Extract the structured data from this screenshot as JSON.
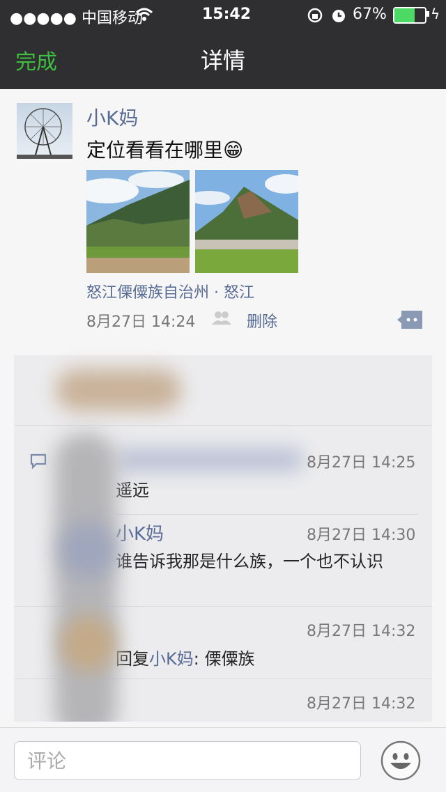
{
  "status_bar": {
    "carrier": "●●●●● 中国移动",
    "time": "15:42",
    "battery": "67%"
  },
  "nav": {
    "left_button": "完成",
    "title": "详情"
  },
  "post": {
    "author": "小K妈",
    "text": "定位看看在哪里",
    "emoji": "😁",
    "location": "怒江傈僳族自治州 · 怒江",
    "time": "8月27日 14:24",
    "delete_label": "删除"
  },
  "comments": [
    {
      "author": "",
      "time": "8月27日 14:25",
      "text": "遥远"
    },
    {
      "author": "小K妈",
      "time": "8月27日 14:30",
      "text": "谁告诉我那是什么族，一个也不认识"
    },
    {
      "author": "",
      "time": "8月27日 14:32",
      "reply_prefix": "回复",
      "reply_to": "小K妈",
      "text": ": 傈僳族"
    },
    {
      "author": "",
      "time": "8月27日 14:32",
      "text": ""
    }
  ],
  "input": {
    "placeholder": "评论"
  },
  "icons": {
    "signal": "signal-dots-icon",
    "wifi": "wifi-icon",
    "lock": "orientation-lock-icon",
    "alarm": "alarm-icon",
    "battery": "battery-icon",
    "charging": "charging-icon",
    "likers": "likers-icon",
    "comment": "comment-bubble-icon",
    "emoji": "emoji-icon"
  },
  "colors": {
    "nav_bg": "#2f2f32",
    "done_green": "#3fbf3f",
    "name_blue": "#576b95",
    "battery_green": "#4cd964"
  }
}
